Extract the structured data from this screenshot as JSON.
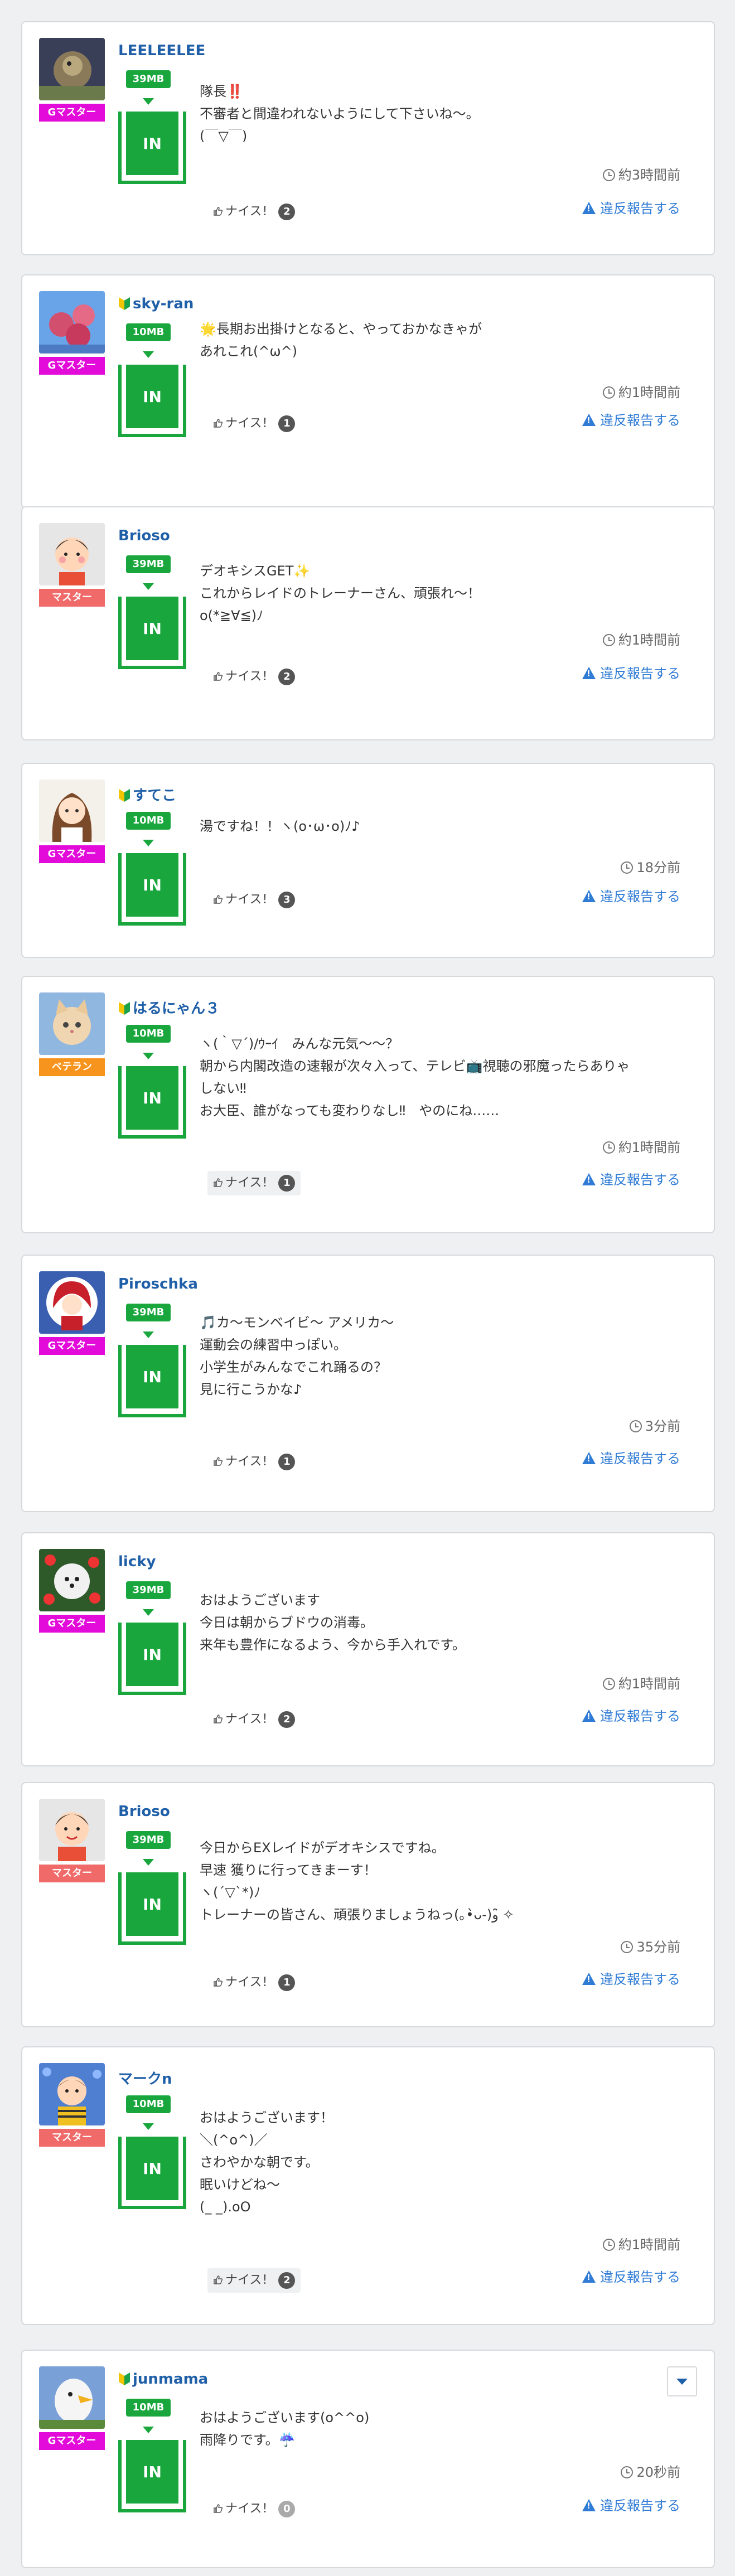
{
  "labels": {
    "in_button": "IN",
    "nice": "ナイス！",
    "report": "違反報告する"
  },
  "colors": {
    "rank_gmaster": "#e20bd9",
    "rank_master": "#f06a6a",
    "rank_veteran": "#f7941d",
    "mb_green": "#19a63d",
    "name_blue": "#1f5fa8",
    "report_blue": "#2f7bd5"
  },
  "posts": [
    {
      "name": "LEELEELEE",
      "beginner": false,
      "rank": "Gマスター",
      "rank_color": "#e20bd9",
      "avatar": "bird-night",
      "mb": "39MB",
      "message": "隊長‼️\n不審者と間違われないようにして下さいね〜。\n(￣▽￣)",
      "time": "約3時間前",
      "nice_count": "2",
      "nice_bg": false
    },
    {
      "name": "sky-ran",
      "beginner": true,
      "rank": "Gマスター",
      "rank_color": "#e20bd9",
      "avatar": "flowers-blue",
      "mb": "10MB",
      "message": "🌟長期お出掛けとなると、やっておかなきゃが\nあれこれ(^ω^)",
      "time": "約1時間前",
      "nice_count": "1",
      "nice_bg": false
    },
    {
      "name": "Brioso",
      "beginner": false,
      "rank": "マスター",
      "rank_color": "#f06a6a",
      "avatar": "trainer-a",
      "mb": "39MB",
      "message": "デオキシスGET✨\nこれからレイドのトレーナーさん、頑張れ〜！\no(*≧∀≦)ﾉ",
      "time": "約1時間前",
      "nice_count": "2",
      "nice_bg": false
    },
    {
      "name": "すてこ",
      "beginner": true,
      "rank": "Gマスター",
      "rank_color": "#e20bd9",
      "avatar": "girl-anime",
      "mb": "10MB",
      "message": "湯ですね！！ヽ(o･ω･o)ﾉ♪",
      "time": "18分前",
      "nice_count": "3",
      "nice_bg": false
    },
    {
      "name": "はるにゃん３",
      "beginner": true,
      "rank": "ベテラン",
      "rank_color": "#f7941d",
      "avatar": "cat",
      "mb": "10MB",
      "message": "ヽ(｀▽´)/ｳｰｲ　みんな元気〜〜？\n朝から内閣改造の速報が次々入って、テレビ📺視聴の邪魔ったらありゃ\nしない‼︎\nお大臣、誰がなっても変わりなし‼︎　やのにね……",
      "time": "約1時間前",
      "nice_count": "1",
      "nice_bg": true
    },
    {
      "name": "Piroschka",
      "beginner": false,
      "rank": "Gマスター",
      "rank_color": "#e20bd9",
      "avatar": "girl-red",
      "mb": "39MB",
      "message": "🎵カ〜モンベイビ〜 アメリカ〜\n運動会の練習中っぽい。\n小学生がみんなでこれ踊るの？\n見に行こうかな♪",
      "time": "3分前",
      "nice_count": "1",
      "nice_bg": false
    },
    {
      "name": "licky",
      "beginner": false,
      "rank": "Gマスター",
      "rank_color": "#e20bd9",
      "avatar": "dog-flowers",
      "mb": "39MB",
      "message": "おはようございます\n今日は朝からブドウの消毒。\n来年も豊作になるよう、今から手入れです。",
      "time": "約1時間前",
      "nice_count": "2",
      "nice_bg": false
    },
    {
      "name": "Brioso",
      "beginner": false,
      "rank": "マスター",
      "rank_color": "#f06a6a",
      "avatar": "trainer-b",
      "mb": "39MB",
      "message": "今日からEXレイドがデオキシスですね。\n早速 獲りに行ってきまーす！\nヽ(´▽`*)ﾉ\nトレーナーの皆さん、頑張りましょうねっ(｡•̀ᴗ-)و ̑̑✧",
      "time": "35分前",
      "nice_count": "1",
      "nice_bg": false
    },
    {
      "name": "マークn",
      "beginner": false,
      "rank": "マスター",
      "rank_color": "#f06a6a",
      "avatar": "boy-flowers",
      "mb": "10MB",
      "message": "おはようございます！\n＼(^o^)／\nさわやかな朝です。\n眠いけどね〜\n(_ _).oO",
      "time": "約1時間前",
      "nice_count": "2",
      "nice_bg": true
    },
    {
      "name": "junmama",
      "beginner": true,
      "rank": "Gマスター",
      "rank_color": "#e20bd9",
      "avatar": "eagle",
      "mb": "10MB",
      "message": "おはようございます(o^^o)\n雨降りです。☔️",
      "time": "20秒前",
      "nice_count": "0",
      "nice_bg": false,
      "has_dropdown": true
    }
  ]
}
